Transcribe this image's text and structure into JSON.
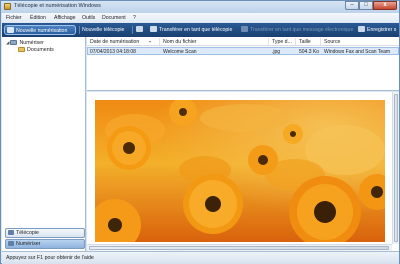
{
  "window": {
    "title": "Télécopie et numérisation Windows"
  },
  "titlebar_buttons": {
    "minimize": "–",
    "maximize": "□",
    "close": "x"
  },
  "menu": [
    "Fichier",
    "Édition",
    "Affichage",
    "Outils",
    "Document",
    "?"
  ],
  "toolbar": {
    "new_scan": "Nouvelle numérisation",
    "new_fax": "Nouvelle télécopie",
    "forward_fax": "Transférer en tant que télécopie",
    "forward_email": "Transférer en tant que message électronique",
    "save_as": "Enregistrer s"
  },
  "tree": {
    "root": "Numériser",
    "child": "Documents"
  },
  "left_tabs": {
    "fax": "Télécopie",
    "scan": "Numériser"
  },
  "list": {
    "columns": [
      "Date de numérisation",
      "Nom du fichier",
      "Type d...",
      "Taille",
      "Source"
    ],
    "rows": [
      {
        "date": "07/04/2013 04:18:08",
        "name": "Welcome Scan",
        "type": ".jpg",
        "size": "504.3 Ko",
        "source": "Windows Fax and Scan Team"
      }
    ]
  },
  "status": {
    "text": "Appuyez sur F1 pour obtenir de l'aide"
  },
  "colors": {
    "toolbar": "#1f4a80",
    "accent_orange": "#f29a1c",
    "selection": "#dbe9f8"
  }
}
